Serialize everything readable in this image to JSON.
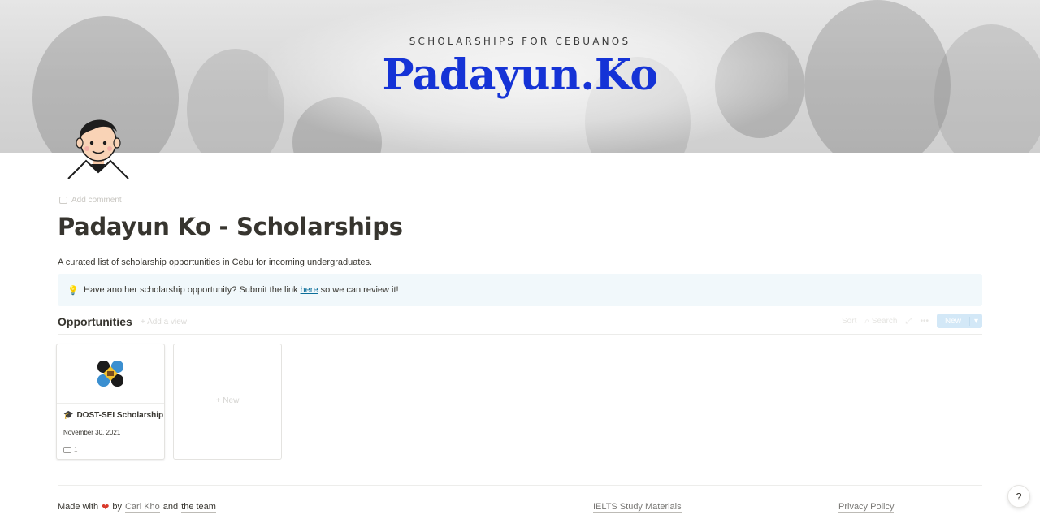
{
  "cover": {
    "subtitle": "SCHOLARSHIPS FOR CEBUANOS",
    "title": "Padayun.Ko"
  },
  "page": {
    "add_comment": "Add comment",
    "title": "Padayun Ko - Scholarships",
    "description": "A curated list of scholarship opportunities in Cebu for incoming undergraduates."
  },
  "callout": {
    "text_before": "Have another scholarship opportunity? Submit the link",
    "link": "here",
    "text_after": "so we can review it!"
  },
  "database": {
    "title": "Opportunities",
    "add_view": "+ Add a view",
    "tools": {
      "sort": "Sort",
      "search": "Search",
      "more": "•••",
      "new": "New"
    },
    "cards": [
      {
        "title": "DOST-SEI Scholarship",
        "date": "November 30, 2021",
        "comments": "1"
      }
    ],
    "new_card": "+ New"
  },
  "footer": {
    "made_with": "Made with",
    "by": "by",
    "author": "Carl Kho",
    "and": "and",
    "team": "the team",
    "ielts": "IELTS Study Materials",
    "privacy": "Privacy Policy"
  },
  "help": "?",
  "colors": {
    "brand": "#1533d6",
    "callout_bg": "#f1f8fb",
    "link": "#0b6e99"
  }
}
